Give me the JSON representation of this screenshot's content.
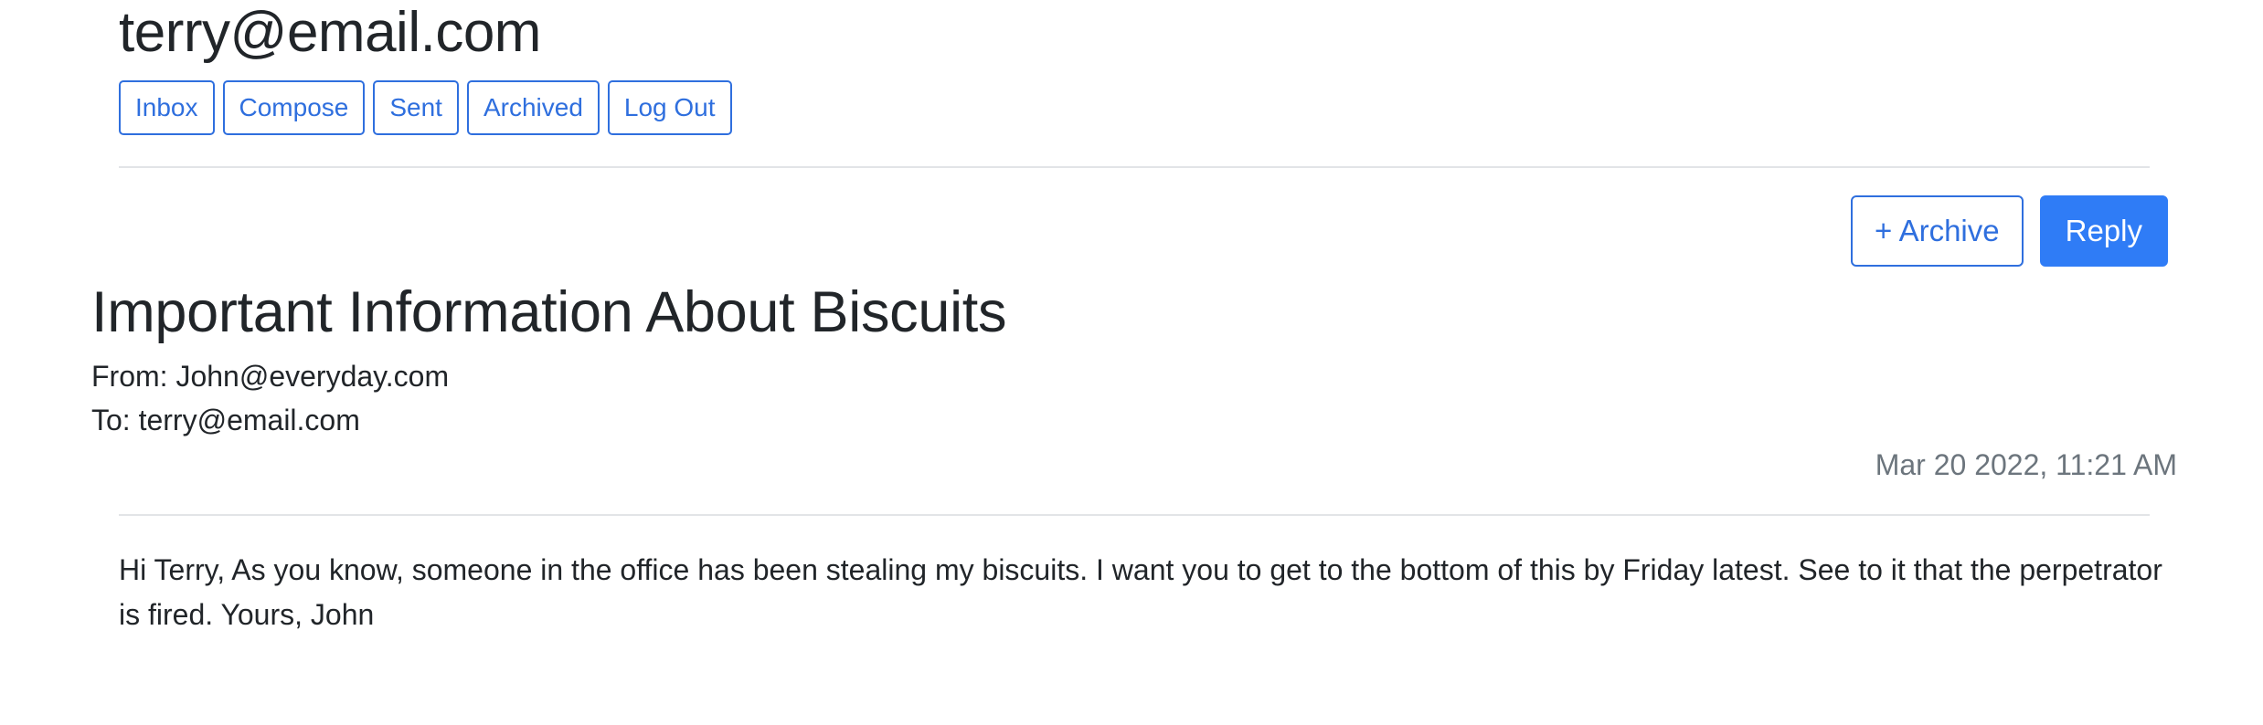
{
  "user": {
    "email": "terry@email.com"
  },
  "nav": {
    "inbox": "Inbox",
    "compose": "Compose",
    "sent": "Sent",
    "archived": "Archived",
    "logout": "Log Out"
  },
  "actions": {
    "archive": "+ Archive",
    "reply": "Reply"
  },
  "email": {
    "subject": "Important Information About Biscuits",
    "from": "From: John@everyday.com",
    "to": "To: terry@email.com",
    "timestamp": "Mar 20 2022, 11:21 AM",
    "body": "Hi Terry, As you know, someone in the office has been stealing my biscuits. I want you to get to the bottom of this by Friday latest. See to it that the perpetrator is fired. Yours, John"
  },
  "colors": {
    "primary": "#2f6fde",
    "primary_fill": "#2f7cf6",
    "muted_text": "#6c757d",
    "divider": "#e2e4e7"
  }
}
